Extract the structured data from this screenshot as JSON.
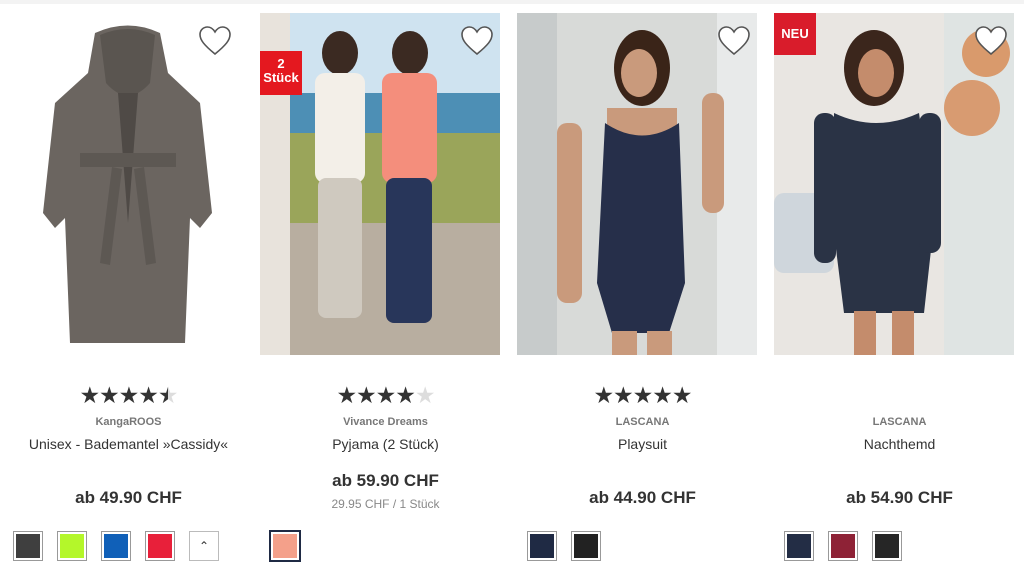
{
  "products": [
    {
      "rating": {
        "value": 4.5,
        "max": 5
      },
      "brand": "KangaROOS",
      "name": "Unisex - Bademantel »Cassidy«",
      "price": "ab 49.90 CHF",
      "unit_price": "",
      "badge": "",
      "swatches": [
        "#3f3f3f",
        "#b4f72a",
        "#1060b8",
        "#e8203a"
      ],
      "more_icon": "chevron-up-icon",
      "more_glyph": "⌃"
    },
    {
      "rating": {
        "value": 4,
        "max": 5
      },
      "brand": "Vivance Dreams",
      "name": "Pyjama (2 Stück)",
      "price": "ab 59.90 CHF",
      "unit_price": "29.95 CHF / 1 Stück",
      "badge": "2\nStück",
      "swatches": [
        "#f4a08a"
      ]
    },
    {
      "rating": {
        "value": 5,
        "max": 5
      },
      "brand": "LASCANA",
      "name": "Playsuit",
      "price": "ab 44.90 CHF",
      "unit_price": "",
      "badge": "",
      "swatches": [
        "#1f2a44",
        "#222222"
      ]
    },
    {
      "rating": {
        "value": 0,
        "max": 5
      },
      "brand": "LASCANA",
      "name": "Nachthemd",
      "price": "ab 54.90 CHF",
      "unit_price": "",
      "badge": "NEU",
      "swatches": [
        "#232d45",
        "#8e2236",
        "#262626"
      ]
    }
  ],
  "icons": {
    "wishlist": "heart-outline-icon",
    "rating": "star-icon"
  }
}
